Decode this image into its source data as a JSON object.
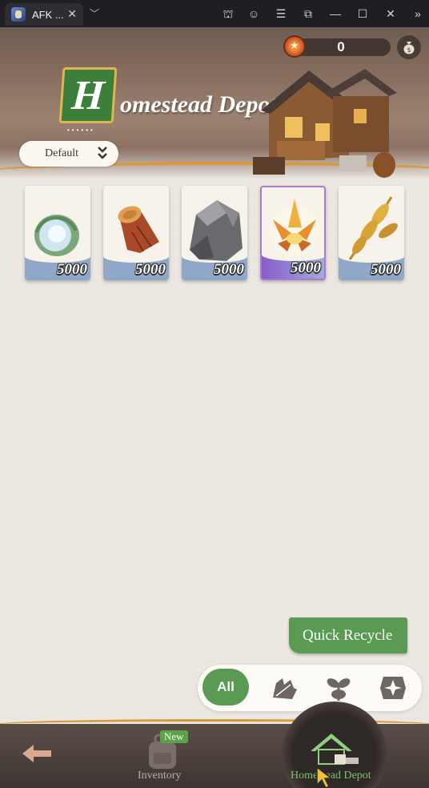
{
  "window": {
    "tab_title": "AFK ...",
    "tab_close": "✕",
    "tab_dropdown": "﹀",
    "controls": [
      "⛫",
      "☺",
      "☰",
      "⧉",
      "—",
      "☐",
      "✕",
      "»"
    ]
  },
  "header": {
    "logo_letter": "H",
    "title": "omestead Depot",
    "currency_value": "0",
    "sort_label": "Default"
  },
  "items": [
    {
      "name": "Spirit Cabbage",
      "count": "5000",
      "rarity": "common"
    },
    {
      "name": "Log",
      "count": "5000",
      "rarity": "common"
    },
    {
      "name": "Stone",
      "count": "5000",
      "rarity": "common"
    },
    {
      "name": "Flame Flower",
      "count": "5000",
      "rarity": "rare"
    },
    {
      "name": "Wheat",
      "count": "5000",
      "rarity": "common"
    }
  ],
  "actions": {
    "quick_recycle": "Quick Recycle"
  },
  "filters": {
    "all": "All",
    "icons": [
      "leaf-filter-icon",
      "sprout-filter-icon",
      "star-filter-icon"
    ]
  },
  "nav": {
    "inventory_label": "Inventory",
    "inventory_badge": "New",
    "depot_label": "Homestead Depot"
  },
  "colors": {
    "accent_green": "#5a9a52",
    "gold_trim": "#d89a3a",
    "background": "#ece8e1"
  }
}
